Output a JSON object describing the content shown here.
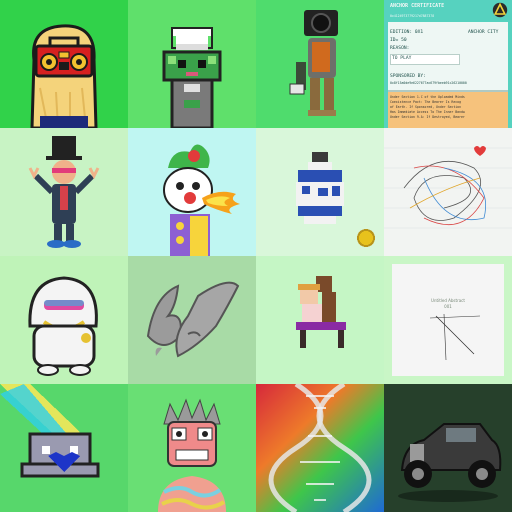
{
  "gallery": {
    "tiles": [
      {
        "name": "boombox-blob",
        "bg": "#31d24a"
      },
      {
        "name": "chef-frog-pixel",
        "bg": "#5fe06b"
      },
      {
        "name": "camera-head-figure",
        "bg": "#4fdc6d"
      },
      {
        "name": "anchor-certificate",
        "bg": "#56d2bf"
      },
      {
        "name": "top-hat-character",
        "bg": "#c8f3c4"
      },
      {
        "name": "fire-breathing-clown",
        "bg": "#bff6f2"
      },
      {
        "name": "voxel-vase",
        "bg": "#d9f7da"
      },
      {
        "name": "scribble-heart",
        "bg": "#f2f4f2"
      },
      {
        "name": "hooded-rapper",
        "bg": "#bff3b8"
      },
      {
        "name": "stone-claws",
        "bg": "#a8dba6"
      },
      {
        "name": "voxel-people",
        "bg": "#c5f6c5"
      },
      {
        "name": "minimal-lines",
        "bg": "#c9f6c6"
      },
      {
        "name": "pixel-ghost-heart",
        "bg": "#57d76b"
      },
      {
        "name": "spiky-skull-portrait",
        "bg": "#69df74"
      },
      {
        "name": "dna-gradient",
        "bg": "#d6283b"
      },
      {
        "name": "vintage-car",
        "bg": "#1f3b25"
      }
    ]
  },
  "certificate": {
    "title": "ANCHOR CERTIFICATE",
    "hash": "0x4124973779217d7887378",
    "edition_label": "EDITION: 0X1",
    "city_label": "ANCHOR CITY",
    "id_label": "ID= 50",
    "reason_label": "REASON:",
    "reason_value": "TO PLAY",
    "sponsored_label": "SPONSORED BY:",
    "sponsor_hash": "0x8f15a0de9e6227677ac679fbeeb91c26210000",
    "legal_lines": [
      "Under Section 1.C of the Uploaded Minds",
      "Coexistence Pact: The Bearer Is Recog",
      "of Earth. If Sponsored, Under Section",
      "Has Immediate Access To The Inner Bandw",
      "Under Section 9.A: If Destroyed, Bearer"
    ]
  },
  "minimal": {
    "caption_line1": "Untitled Abstract",
    "caption_line2": "001"
  },
  "colors": {
    "green": "#31d24a",
    "mint": "#bff3b8",
    "teal": "#56d2bf",
    "red": "#d6283b"
  }
}
